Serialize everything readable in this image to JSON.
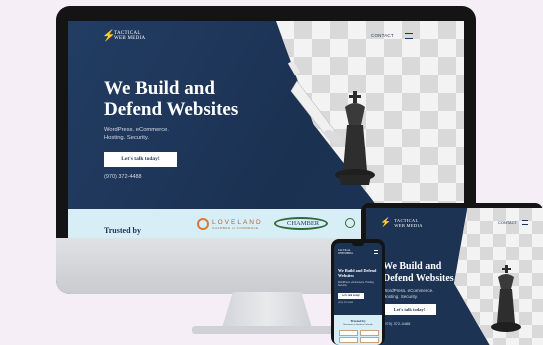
{
  "desktop": {
    "logo_text_line1": "TACTICAL",
    "logo_text_line2": "WEB MEDIA",
    "nav_contact": "CONTACT",
    "headline_line1": "We Build and",
    "headline_line2": "Defend Websites",
    "subtitle_line1": "WordPress. eCommerce.",
    "subtitle_line2": "Hosting. Security.",
    "cta_label": "Let's talk today!",
    "phone": "(970) 372-4488",
    "trusted_label": "Trusted by",
    "partner1_name": "LOVELAND",
    "partner1_sub": "CHAMBER of COMMERCE",
    "partner2_name": "CHAMBER"
  },
  "tablet": {
    "logo_text_line1": "TACTICAL",
    "logo_text_line2": "WEB MEDIA",
    "nav_contact": "CONTACT",
    "headline_line1": "We Build and",
    "headline_line2": "Defend Websites",
    "subtitle_line1": "WordPress. eCommerce.",
    "subtitle_line2": "Hosting. Security.",
    "cta_label": "Let's talk today!",
    "phone": "(970) 372-4488"
  },
  "phone": {
    "logo_text_line1": "TACTICAL",
    "logo_text_line2": "WEB MEDIA",
    "headline": "We Build and Defend Websites",
    "subtitle": "WordPress. eCommerce. Hosting. Security.",
    "cta_label": "Let's talk today!",
    "phone": "(970) 372-4488",
    "trusted_label": "Trusted by",
    "trusted_sub": "Businesses in Northern Colorado"
  },
  "colors": {
    "navy": "#1c3353",
    "trusted_bg": "#d8eef7",
    "background": "#f6eef7"
  }
}
